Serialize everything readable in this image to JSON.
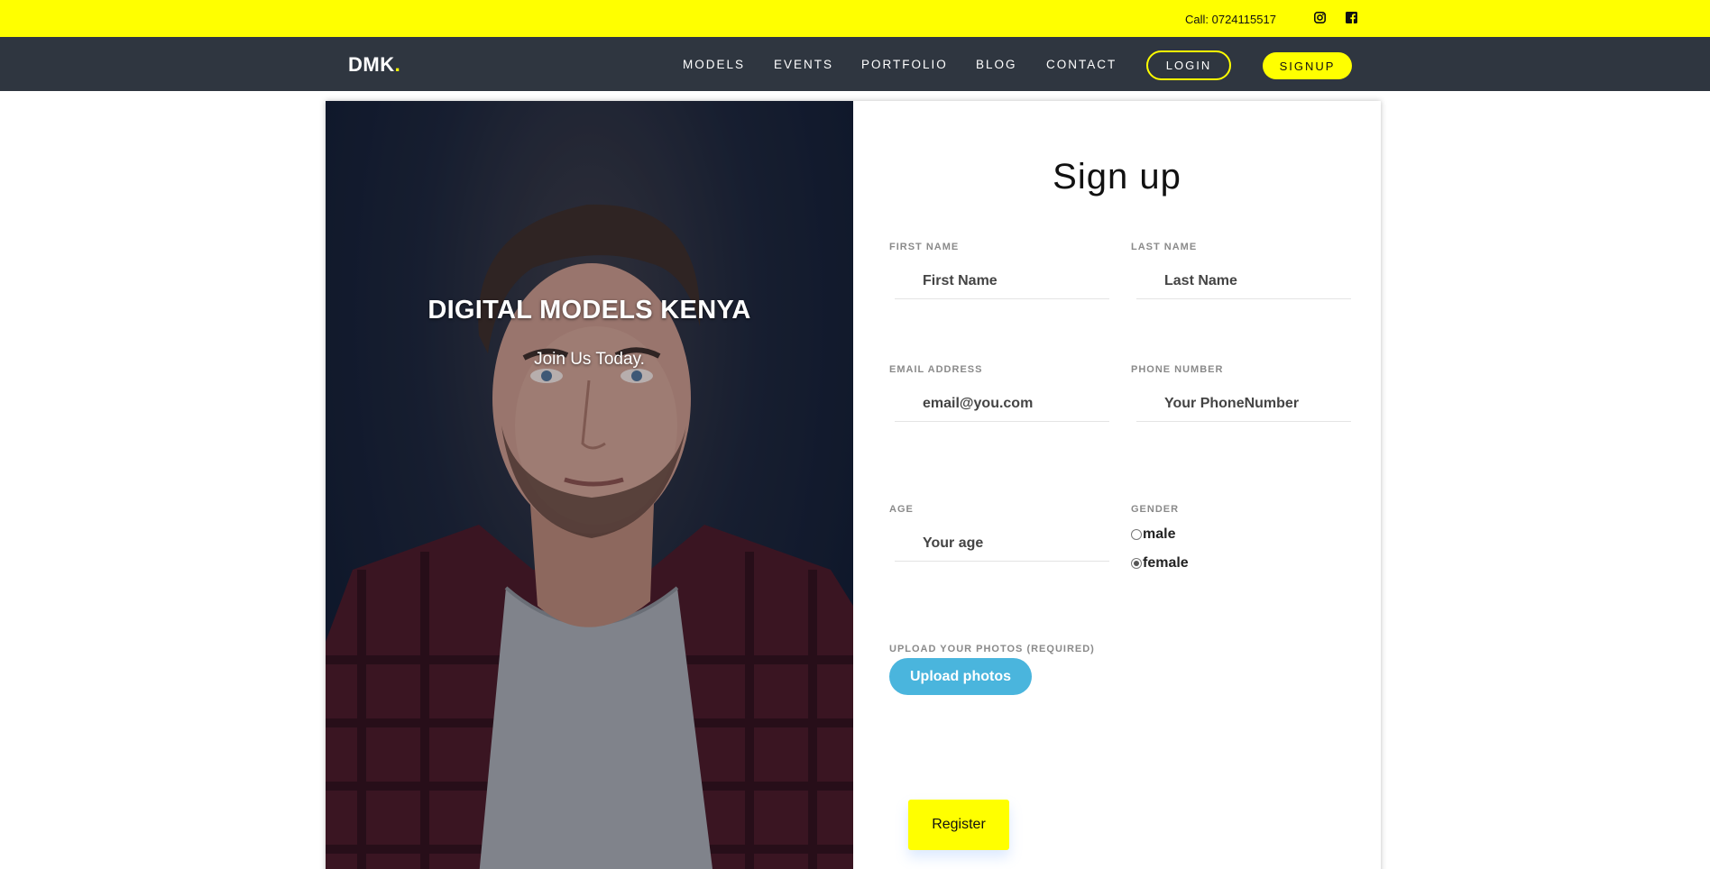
{
  "topbar": {
    "call_text": "Call: 0724115517",
    "icons": [
      "instagram-icon",
      "facebook-icon"
    ],
    "bg_color": "#ffff00"
  },
  "navbar": {
    "logo_text": "DMK",
    "logo_dot": ".",
    "links": [
      "MODELS",
      "EVENTS",
      "PORTFOLIO",
      "BLOG",
      "CONTACT"
    ],
    "login_label": "LOGIN",
    "signup_label": "SIGNUP",
    "bg_color": "#2f3640",
    "accent_color": "#ffff00"
  },
  "hero": {
    "title": "DIGITAL MODELS KENYA",
    "subtitle": "Join Us Today."
  },
  "form": {
    "title": "Sign up",
    "first_name": {
      "label": "FIRST NAME",
      "placeholder": "First Name"
    },
    "last_name": {
      "label": "LAST NAME",
      "placeholder": "Last Name"
    },
    "email": {
      "label": "EMAIL ADDRESS",
      "placeholder": "email@you.com"
    },
    "phone": {
      "label": "PHONE NUMBER",
      "placeholder": "Your PhoneNumber"
    },
    "age": {
      "label": "AGE",
      "placeholder": "Your age"
    },
    "gender": {
      "label": "GENDER",
      "options": [
        "male",
        "female"
      ],
      "selected": "female"
    },
    "upload": {
      "label": "UPLOAD YOUR PHOTOS (REQUIRED)",
      "button_label": "Upload photos",
      "button_color": "#4ab5dd"
    },
    "register_label": "Register"
  }
}
